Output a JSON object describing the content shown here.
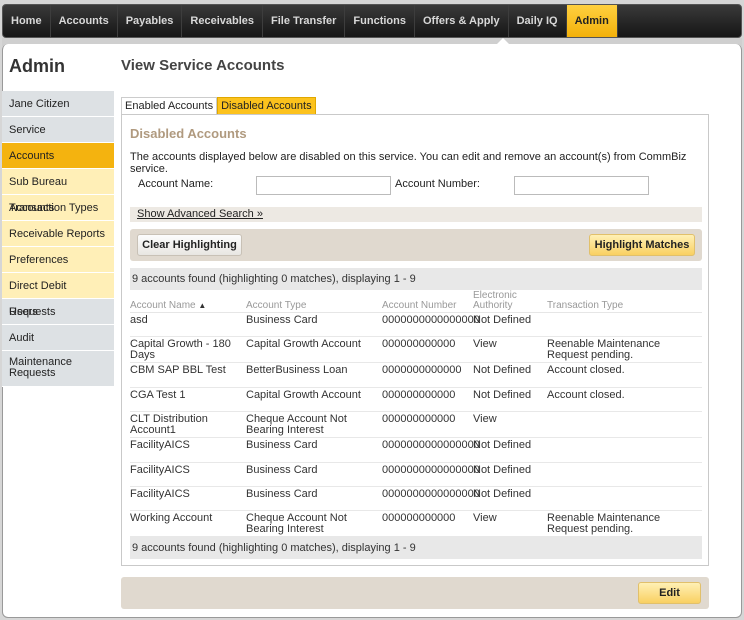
{
  "topnav": {
    "items": [
      {
        "label": "Home"
      },
      {
        "label": "Accounts"
      },
      {
        "label": "Payables"
      },
      {
        "label": "Receivables"
      },
      {
        "label": "File Transfer"
      },
      {
        "label": "Functions"
      },
      {
        "label": "Offers & Apply"
      },
      {
        "label": "Daily IQ"
      },
      {
        "label": "Admin",
        "active": true
      }
    ]
  },
  "sidebar": {
    "title": "Admin",
    "items": [
      {
        "label": "Jane Citizen"
      },
      {
        "label": "Service"
      },
      {
        "label": "Accounts",
        "active": true
      },
      {
        "label": "Sub Bureau Accounts"
      },
      {
        "label": "Transaction Types"
      },
      {
        "label": "Receivable Reports"
      },
      {
        "label": "Preferences"
      },
      {
        "label": "Direct Debit Requests"
      },
      {
        "label": "Users"
      },
      {
        "label": "Audit"
      },
      {
        "label": "Maintenance Requests"
      }
    ]
  },
  "main": {
    "page_title": "View Service Accounts",
    "tabs": [
      {
        "label": "Enabled Accounts"
      },
      {
        "label": "Disabled Accounts",
        "active": true
      }
    ],
    "panel": {
      "title": "Disabled Accounts",
      "description": "The accounts displayed below are disabled on this service. You can edit and remove an account(s) from CommBiz service.",
      "account_name_label": "Account Name:",
      "account_name_value": "",
      "account_number_label": "Account Number:",
      "account_number_value": "",
      "advanced_search_label": "Show Advanced Search »",
      "clear_highlighting_label": "Clear Highlighting",
      "highlight_matches_label": "Highlight Matches",
      "summary_top": "9 accounts found (highlighting 0 matches), displaying 1 - 9",
      "summary_bottom": "9 accounts found (highlighting 0 matches), displaying 1 - 9",
      "table": {
        "headers": {
          "account_name": "Account Name",
          "sort_indicator": "▲",
          "account_type": "Account Type",
          "account_number": "Account Number",
          "electronic_authority": "Electronic Authority",
          "transaction_type": "Transaction Type"
        },
        "rows": [
          {
            "name": "asd",
            "type": "Business Card",
            "number": "0000000000000000",
            "authority": "Not Defined",
            "transaction": ""
          },
          {
            "name": "Capital Growth - 180 Days",
            "type": "Capital Growth Account",
            "number": "000000000000",
            "authority": "View",
            "transaction": "Reenable Maintenance Request pending."
          },
          {
            "name": "CBM SAP BBL Test",
            "type": "BetterBusiness Loan",
            "number": "0000000000000",
            "authority": "Not Defined",
            "transaction": "Account closed."
          },
          {
            "name": "CGA Test 1",
            "type": "Capital Growth Account",
            "number": "000000000000",
            "authority": "Not Defined",
            "transaction": "Account closed."
          },
          {
            "name": "CLT Distribution Account1",
            "type": "Cheque Account Not Bearing Interest",
            "number": "000000000000",
            "authority": "View",
            "transaction": ""
          },
          {
            "name": "FacilityAICS",
            "type": "Business Card",
            "number": "0000000000000000",
            "authority": "Not Defined",
            "transaction": ""
          },
          {
            "name": "FacilityAICS",
            "type": "Business Card",
            "number": "0000000000000000",
            "authority": "Not Defined",
            "transaction": ""
          },
          {
            "name": "FacilityAICS",
            "type": "Business Card",
            "number": "0000000000000000",
            "authority": "Not Defined",
            "transaction": ""
          },
          {
            "name": "Working Account",
            "type": "Cheque Account Not Bearing Interest",
            "number": "000000000000",
            "authority": "View",
            "transaction": "Reenable Maintenance Request pending."
          }
        ]
      }
    },
    "edit_label": "Edit"
  }
}
